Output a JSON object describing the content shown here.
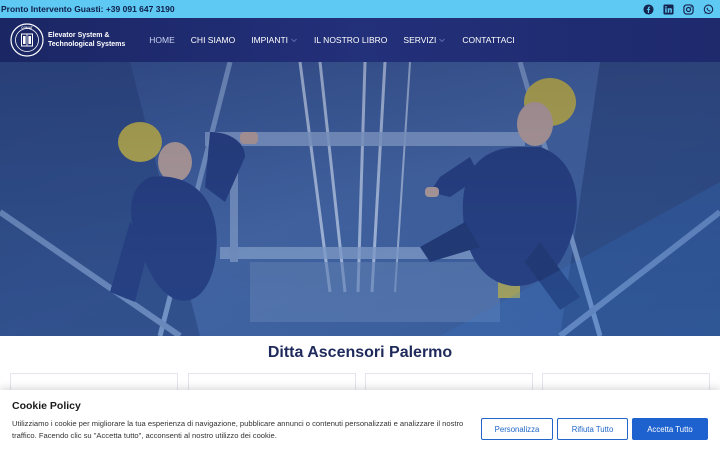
{
  "topbar": {
    "phone_text": "Pronto Intervento Guasti: +39 091 647 3190",
    "socials": [
      "facebook-icon",
      "linkedin-icon",
      "instagram-icon",
      "whatsapp-icon"
    ]
  },
  "header": {
    "logo_text_line1": "Elevator System &",
    "logo_text_line2": "Technological Systems",
    "logo_seal_text": "COMAT",
    "nav": [
      {
        "label": "HOME",
        "active": true,
        "dropdown": false
      },
      {
        "label": "CHI SIAMO",
        "active": false,
        "dropdown": false
      },
      {
        "label": "IMPIANTI",
        "active": false,
        "dropdown": true
      },
      {
        "label": "IL NOSTRO LIBRO",
        "active": false,
        "dropdown": false
      },
      {
        "label": "SERVIZI",
        "active": false,
        "dropdown": true
      },
      {
        "label": "CONTATTACI",
        "active": false,
        "dropdown": false
      }
    ]
  },
  "main": {
    "section_title": "Ditta Ascensori Palermo"
  },
  "cookie": {
    "title": "Cookie Policy",
    "text": "Utilizziamo i cookie per migliorare la tua esperienza di navigazione, pubblicare annunci o contenuti personalizzati e analizzare il nostro traffico. Facendo clic su \"Accetta tutto\", acconsenti al nostro utilizzo dei cookie.",
    "customize_label": "Personalizza",
    "reject_label": "Rifiuta Tutto",
    "accept_label": "Accetta Tutto"
  },
  "colors": {
    "topbar": "#5ec9f2",
    "header": "#1b2664",
    "accent": "#1e62cf",
    "title": "#1f2a5c"
  }
}
